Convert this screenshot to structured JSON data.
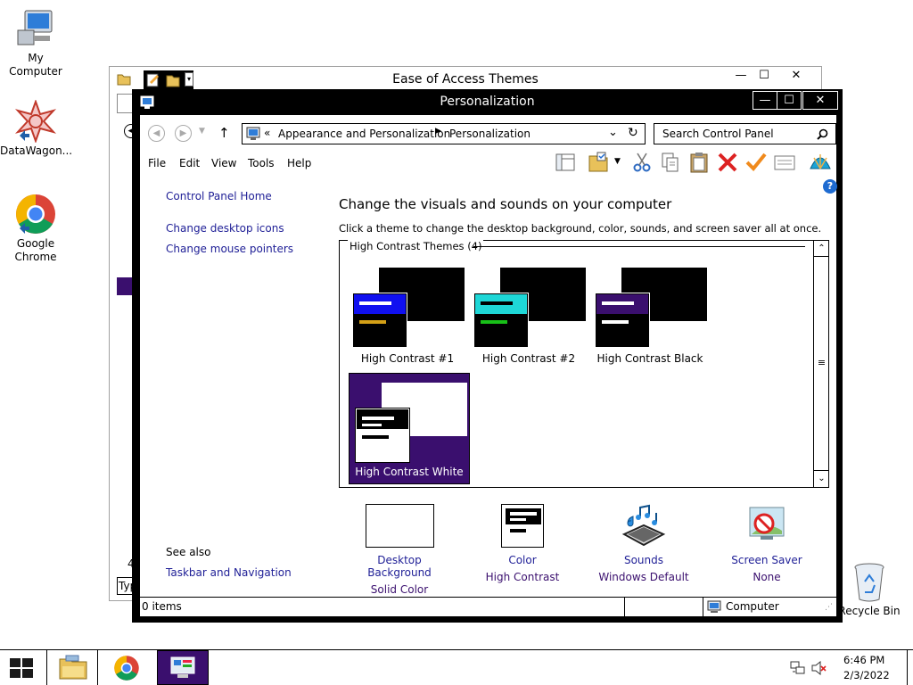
{
  "desktop": {
    "icons": [
      {
        "label": "My Computer"
      },
      {
        "label": "DataWagon..."
      },
      {
        "label": "Google Chrome"
      },
      {
        "label": "Recycle Bin"
      }
    ]
  },
  "bg_window": {
    "title": "Ease of Access Themes",
    "fragment_a": "4",
    "fragment_b": "Typ"
  },
  "window": {
    "title": "Personalization",
    "breadcrumb": [
      "Appearance and Personalization",
      "Personalization"
    ],
    "breadcrumb_prefix": "«",
    "search_placeholder": "Search Control Panel",
    "menu": [
      "File",
      "Edit",
      "View",
      "Tools",
      "Help"
    ],
    "sidebar": {
      "home": "Control Panel Home",
      "links": [
        "Change desktop icons",
        "Change mouse pointers"
      ],
      "see_also": "See also",
      "see_also_links": [
        "Taskbar and Navigation"
      ]
    },
    "heading": "Change the visuals and sounds on your computer",
    "subheading": "Click a theme to change the desktop background, color, sounds, and screen saver all at once.",
    "group_label": "High Contrast Themes (4)",
    "themes": [
      {
        "label": "High Contrast #1",
        "accent": "#1010f0",
        "line1": "#ffffff",
        "line2": "#d4a017",
        "selected": false
      },
      {
        "label": "High Contrast #2",
        "accent": "#1ed7d7",
        "line1": "#000000",
        "line2": "#18c018",
        "selected": false
      },
      {
        "label": "High Contrast Black",
        "accent": "#3a0f6e",
        "line1": "#ffffff",
        "line2": "#ffffff",
        "selected": false
      },
      {
        "label": "High Contrast White",
        "accent": "#ffffff",
        "line1": "#000000",
        "line2": "#000000",
        "selected": true
      }
    ],
    "selection_color": "#3a0f6e",
    "bottom": [
      {
        "title": "Desktop Background",
        "value": "Solid Color"
      },
      {
        "title": "Color",
        "value": "High Contrast"
      },
      {
        "title": "Sounds",
        "value": "Windows Default"
      },
      {
        "title": "Screen Saver",
        "value": "None"
      }
    ],
    "status_items": "0 items",
    "status_zone": "Computer"
  },
  "taskbar": {
    "time": "6:46 PM",
    "date": "2/3/2022"
  }
}
